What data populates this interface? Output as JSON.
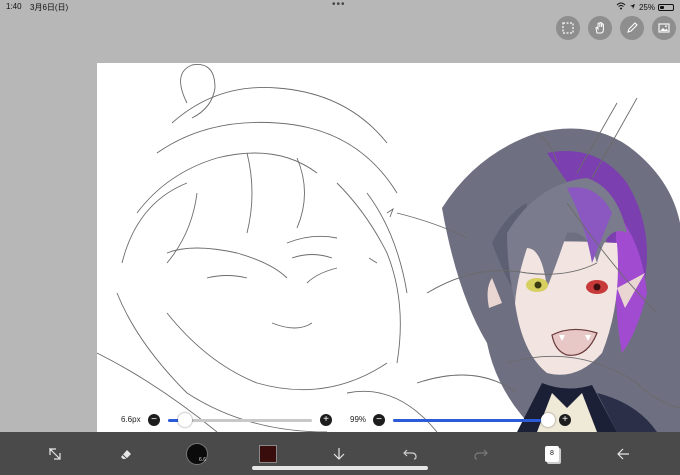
{
  "status_bar": {
    "time": "1:40",
    "date": "3月6日(日)",
    "dots": "•••",
    "battery_text": "25%",
    "battery_level": 0.25
  },
  "top_tools": [
    {
      "name": "selection-tool",
      "icon": "dashed-square-icon"
    },
    {
      "name": "hand-tool",
      "icon": "hand-icon"
    },
    {
      "name": "pen-tool",
      "icon": "pencil-icon"
    },
    {
      "name": "image-tool",
      "icon": "picture-icon"
    }
  ],
  "sliders": {
    "brush_size_label": "6.6px",
    "brush_size_level": 0.12,
    "opacity_label": "99%",
    "opacity_level": 0.99,
    "minus": "−",
    "plus": "+"
  },
  "bottom_bar": {
    "brush_size_text": "6.6",
    "layer_count": "8",
    "colors": {
      "primary": "#3a0d0d",
      "bar": "#4a4a4a",
      "accent": "#2b5bd7"
    }
  }
}
